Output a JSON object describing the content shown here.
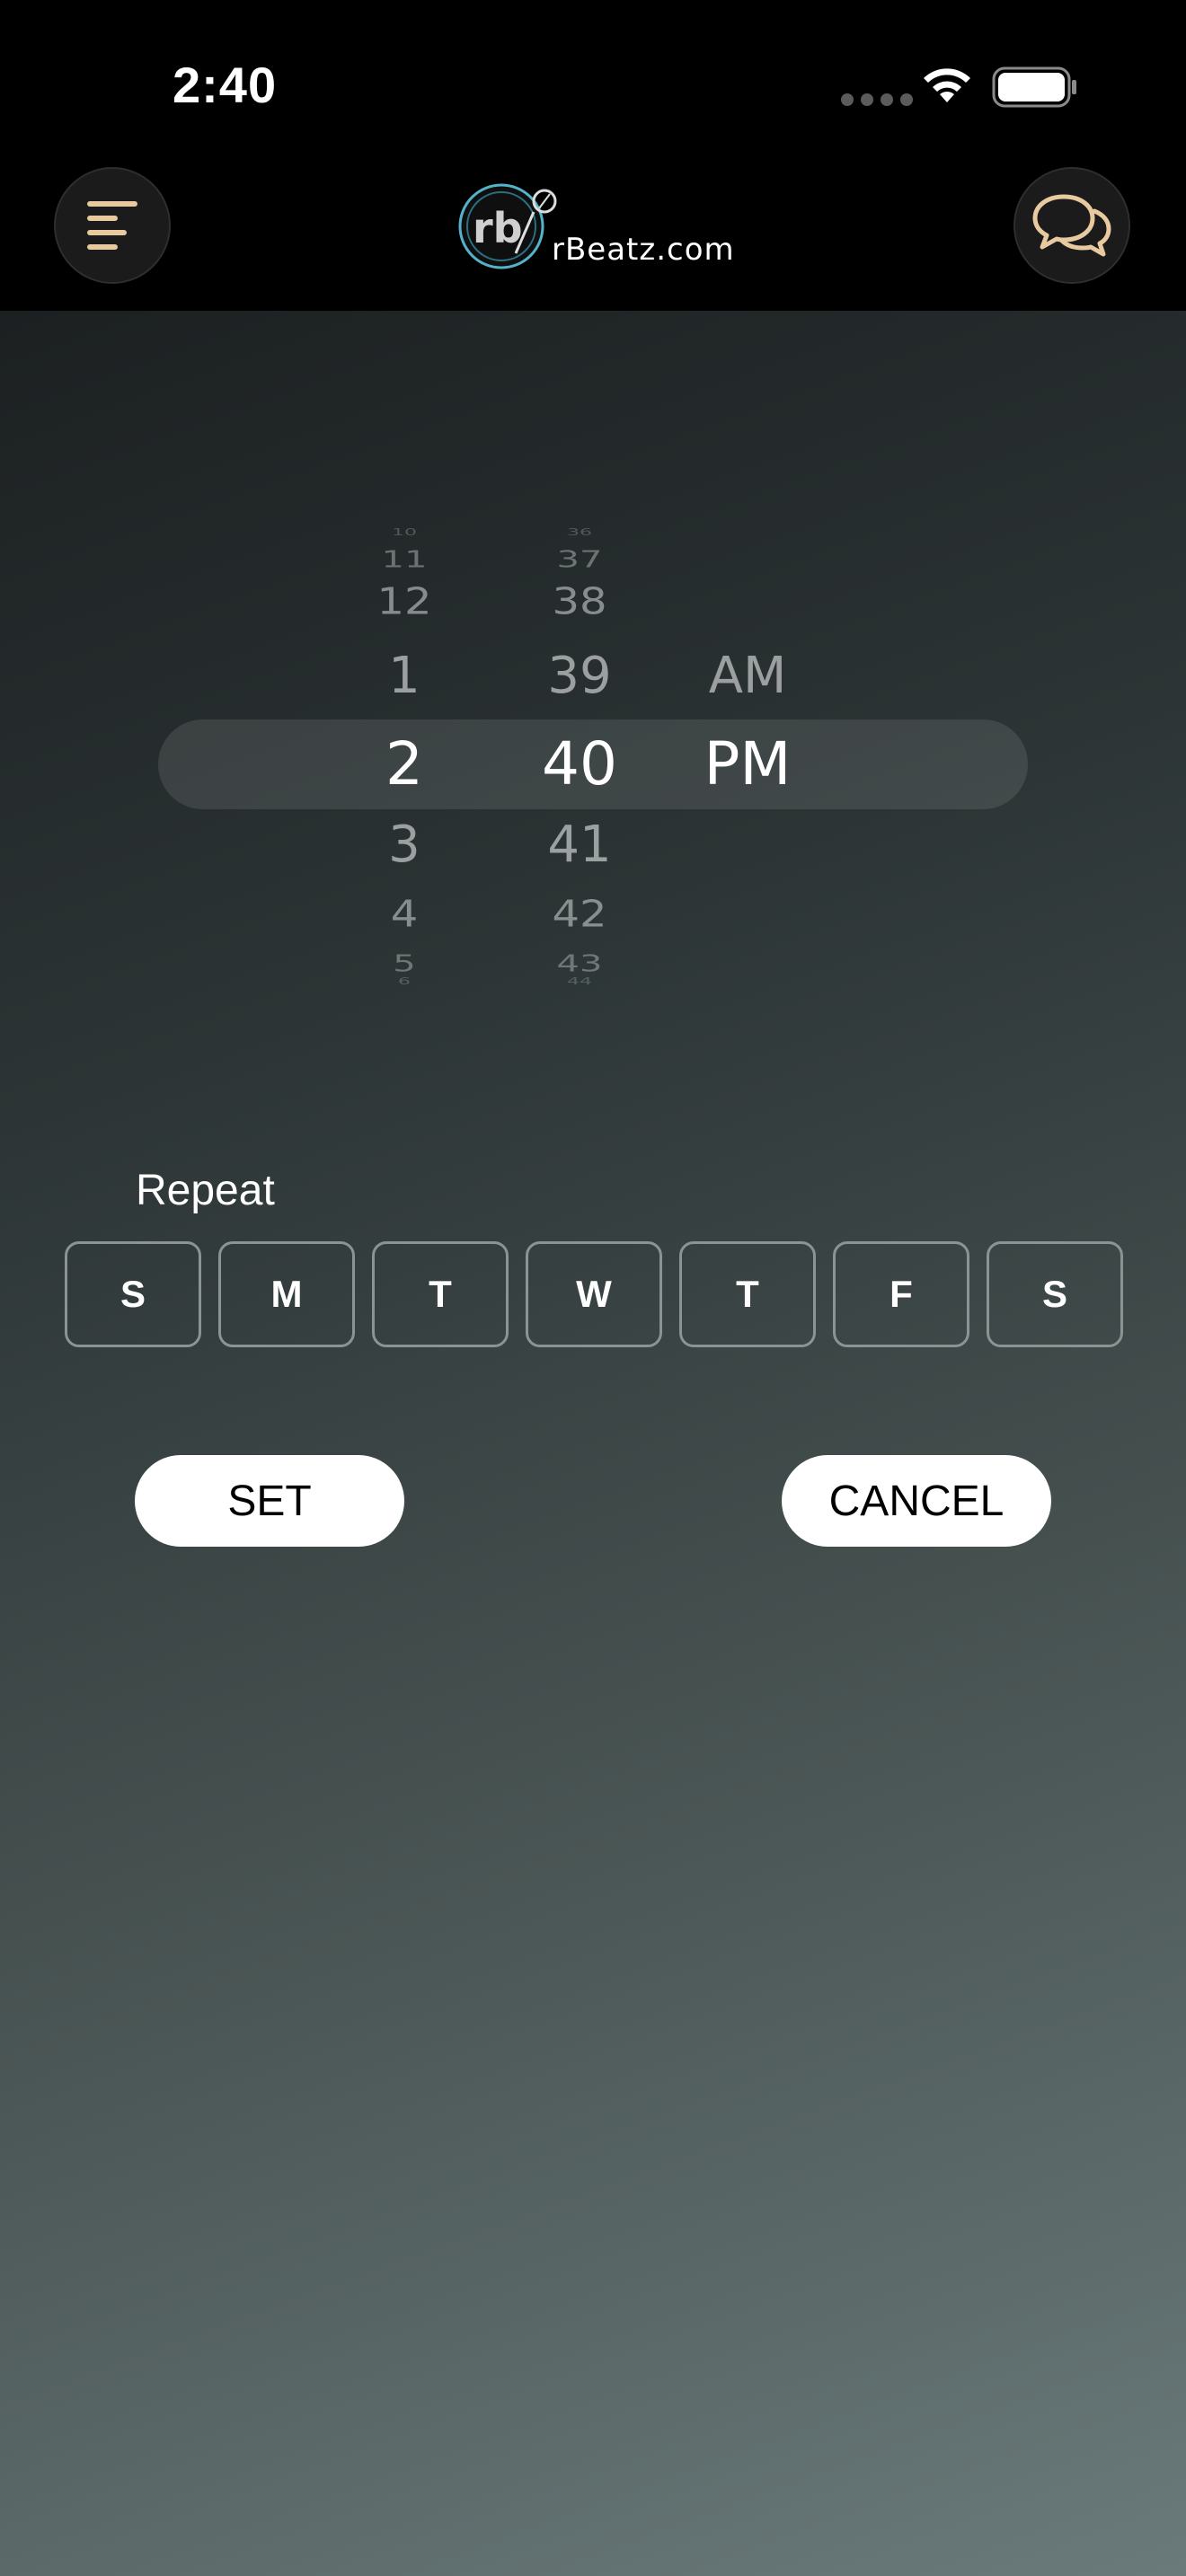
{
  "status_bar": {
    "time": "2:40",
    "wifi_icon": "wifi-icon",
    "battery_icon": "battery-icon"
  },
  "header": {
    "menu_icon": "menu-icon",
    "logo_text": "rBeatz.com",
    "chat_icon": "chat-bubbles-icon",
    "accent_color": "#e8c9a0"
  },
  "picker": {
    "hours": [
      "10",
      "11",
      "12",
      "1",
      "2",
      "3",
      "4",
      "5",
      "6"
    ],
    "minutes": [
      "36",
      "37",
      "38",
      "39",
      "40",
      "41",
      "42",
      "43",
      "44"
    ],
    "ampm": [
      "AM",
      "PM"
    ],
    "selected": {
      "hour": "2",
      "minute": "40",
      "ampm": "PM"
    }
  },
  "repeat": {
    "label": "Repeat",
    "days": [
      "S",
      "M",
      "T",
      "W",
      "T",
      "F",
      "S"
    ]
  },
  "actions": {
    "set_label": "SET",
    "cancel_label": "CANCEL"
  }
}
